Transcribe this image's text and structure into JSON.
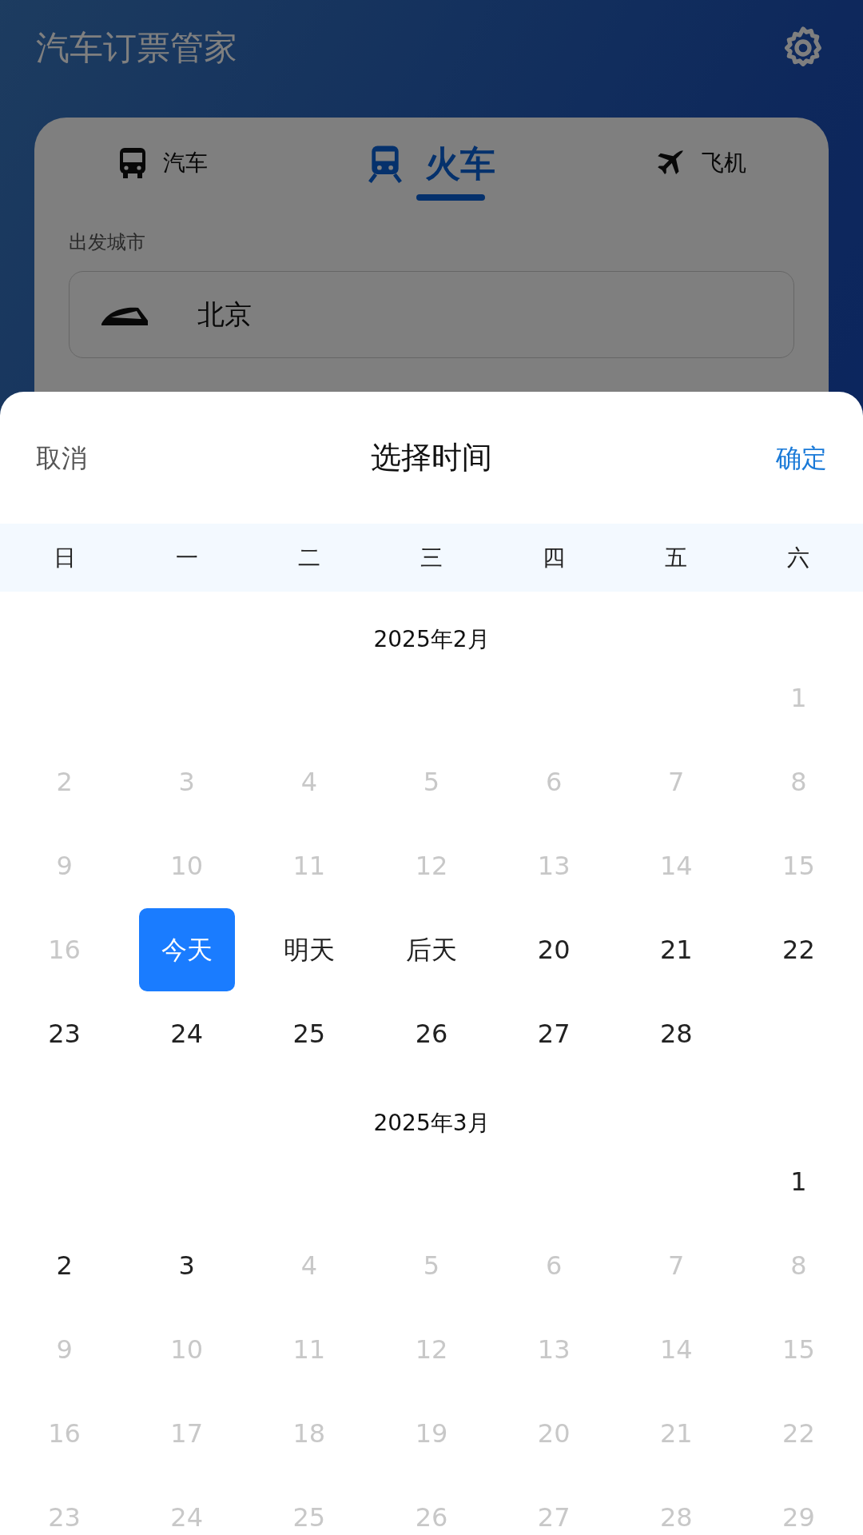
{
  "app_bar": {
    "title": "汽车订票管家"
  },
  "tabs": [
    {
      "label": "汽车",
      "kind": "bus",
      "selected": false
    },
    {
      "label": "火车",
      "kind": "train",
      "selected": true
    },
    {
      "label": "飞机",
      "kind": "plane",
      "selected": false
    }
  ],
  "departure": {
    "label": "出发城市",
    "value": "北京"
  },
  "picker": {
    "cancel": "取消",
    "title": "选择时间",
    "confirm": "确定",
    "weekdays": [
      "日",
      "一",
      "二",
      "三",
      "四",
      "五",
      "六"
    ],
    "months": [
      {
        "title": "2025年2月",
        "weeks": [
          [
            {
              "kind": "blank"
            },
            {
              "kind": "blank"
            },
            {
              "kind": "blank"
            },
            {
              "kind": "blank"
            },
            {
              "kind": "blank"
            },
            {
              "kind": "blank"
            },
            {
              "kind": "day",
              "text": "1",
              "disabled": true,
              "selected": false
            }
          ],
          [
            {
              "text": "2",
              "disabled": true,
              "selected": false
            },
            {
              "text": "3",
              "disabled": true,
              "selected": false
            },
            {
              "text": "4",
              "disabled": true,
              "selected": false
            },
            {
              "text": "5",
              "disabled": true,
              "selected": false
            },
            {
              "text": "6",
              "disabled": true,
              "selected": false
            },
            {
              "text": "7",
              "disabled": true,
              "selected": false
            },
            {
              "text": "8",
              "disabled": true,
              "selected": false
            }
          ],
          [
            {
              "text": "9",
              "disabled": true,
              "selected": false
            },
            {
              "text": "10",
              "disabled": true,
              "selected": false
            },
            {
              "text": "11",
              "disabled": true,
              "selected": false
            },
            {
              "text": "12",
              "disabled": true,
              "selected": false
            },
            {
              "text": "13",
              "disabled": true,
              "selected": false
            },
            {
              "text": "14",
              "disabled": true,
              "selected": false
            },
            {
              "text": "15",
              "disabled": true,
              "selected": false
            }
          ],
          [
            {
              "text": "16",
              "disabled": true,
              "selected": false
            },
            {
              "text": "今天",
              "disabled": false,
              "selected": true
            },
            {
              "text": "明天",
              "disabled": false,
              "selected": false
            },
            {
              "text": "后天",
              "disabled": false,
              "selected": false
            },
            {
              "text": "20",
              "disabled": false,
              "selected": false
            },
            {
              "text": "21",
              "disabled": false,
              "selected": false
            },
            {
              "text": "22",
              "disabled": false,
              "selected": false
            }
          ],
          [
            {
              "text": "23",
              "disabled": false,
              "selected": false
            },
            {
              "text": "24",
              "disabled": false,
              "selected": false
            },
            {
              "text": "25",
              "disabled": false,
              "selected": false
            },
            {
              "text": "26",
              "disabled": false,
              "selected": false
            },
            {
              "text": "27",
              "disabled": false,
              "selected": false
            },
            {
              "text": "28",
              "disabled": false,
              "selected": false
            },
            {
              "kind": "blank"
            }
          ]
        ]
      },
      {
        "title": "2025年3月",
        "weeks": [
          [
            {
              "kind": "blank"
            },
            {
              "kind": "blank"
            },
            {
              "kind": "blank"
            },
            {
              "kind": "blank"
            },
            {
              "kind": "blank"
            },
            {
              "kind": "blank"
            },
            {
              "kind": "day",
              "text": "1",
              "disabled": false,
              "selected": false
            }
          ],
          [
            {
              "text": "2",
              "disabled": false,
              "selected": false
            },
            {
              "text": "3",
              "disabled": false,
              "selected": false
            },
            {
              "text": "4",
              "disabled": true,
              "selected": false
            },
            {
              "text": "5",
              "disabled": true,
              "selected": false
            },
            {
              "text": "6",
              "disabled": true,
              "selected": false
            },
            {
              "text": "7",
              "disabled": true,
              "selected": false
            },
            {
              "text": "8",
              "disabled": true,
              "selected": false
            }
          ],
          [
            {
              "text": "9",
              "disabled": true,
              "selected": false
            },
            {
              "text": "10",
              "disabled": true,
              "selected": false
            },
            {
              "text": "11",
              "disabled": true,
              "selected": false
            },
            {
              "text": "12",
              "disabled": true,
              "selected": false
            },
            {
              "text": "13",
              "disabled": true,
              "selected": false
            },
            {
              "text": "14",
              "disabled": true,
              "selected": false
            },
            {
              "text": "15",
              "disabled": true,
              "selected": false
            }
          ],
          [
            {
              "text": "16",
              "disabled": true,
              "selected": false
            },
            {
              "text": "17",
              "disabled": true,
              "selected": false
            },
            {
              "text": "18",
              "disabled": true,
              "selected": false
            },
            {
              "text": "19",
              "disabled": true,
              "selected": false
            },
            {
              "text": "20",
              "disabled": true,
              "selected": false
            },
            {
              "text": "21",
              "disabled": true,
              "selected": false
            },
            {
              "text": "22",
              "disabled": true,
              "selected": false
            }
          ],
          [
            {
              "text": "23",
              "disabled": true,
              "selected": false
            },
            {
              "text": "24",
              "disabled": true,
              "selected": false
            },
            {
              "text": "25",
              "disabled": true,
              "selected": false
            },
            {
              "text": "26",
              "disabled": true,
              "selected": false
            },
            {
              "text": "27",
              "disabled": true,
              "selected": false
            },
            {
              "text": "28",
              "disabled": true,
              "selected": false
            },
            {
              "text": "29",
              "disabled": true,
              "selected": false
            }
          ]
        ]
      }
    ]
  }
}
